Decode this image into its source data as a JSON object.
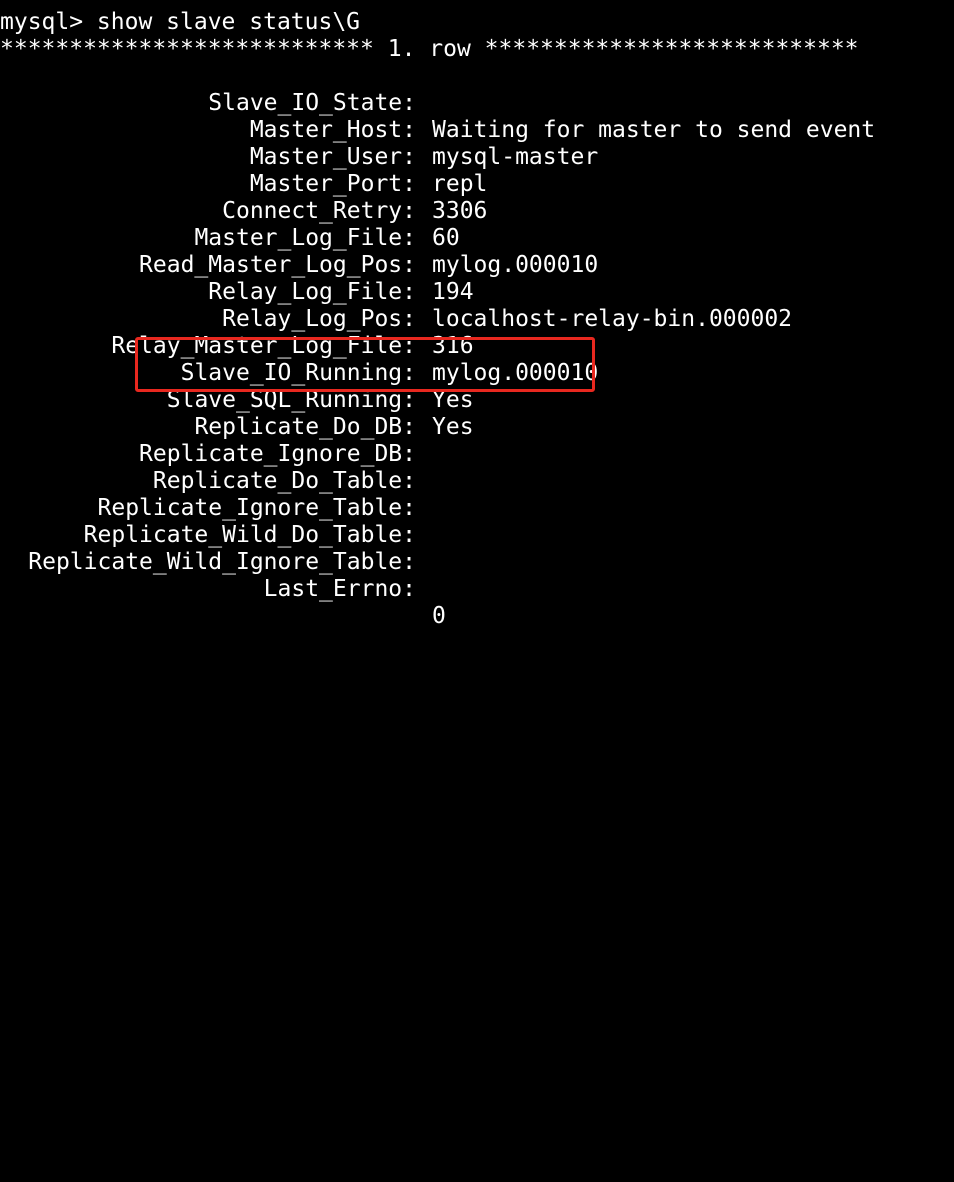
{
  "prompt": {
    "text": "mysql> show slave status\\G"
  },
  "row_header": {
    "text": "*************************** 1. row ***************************"
  },
  "fields": [
    {
      "name": "Slave_IO_State:",
      "value": "Waiting for master to send event"
    },
    {
      "name": "Master_Host:",
      "value": "mysql-master"
    },
    {
      "name": "Master_User:",
      "value": "repl"
    },
    {
      "name": "Master_Port:",
      "value": "3306"
    },
    {
      "name": "Connect_Retry:",
      "value": "60"
    },
    {
      "name": "Master_Log_File:",
      "value": "mylog.000010"
    },
    {
      "name": "Read_Master_Log_Pos:",
      "value": "194"
    },
    {
      "name": "Relay_Log_File:",
      "value": "localhost-relay-bin.000002"
    },
    {
      "name": "Relay_Log_Pos:",
      "value": "316"
    },
    {
      "name": "Relay_Master_Log_File:",
      "value": "mylog.000010"
    },
    {
      "name": "Slave_IO_Running:",
      "value": "Yes"
    },
    {
      "name": "Slave_SQL_Running:",
      "value": "Yes"
    },
    {
      "name": "Replicate_Do_DB:",
      "value": ""
    },
    {
      "name": "Replicate_Ignore_DB:",
      "value": ""
    },
    {
      "name": "Replicate_Do_Table:",
      "value": ""
    },
    {
      "name": "Replicate_Ignore_Table:",
      "value": ""
    },
    {
      "name": "Replicate_Wild_Do_Table:",
      "value": ""
    },
    {
      "name": "Replicate_Wild_Ignore_Table:",
      "value": ""
    },
    {
      "name": "Last_Errno:",
      "value": "0"
    }
  ],
  "colors": {
    "background": "#000000",
    "text": "#ffffff",
    "highlight_border": "#e8281f"
  }
}
